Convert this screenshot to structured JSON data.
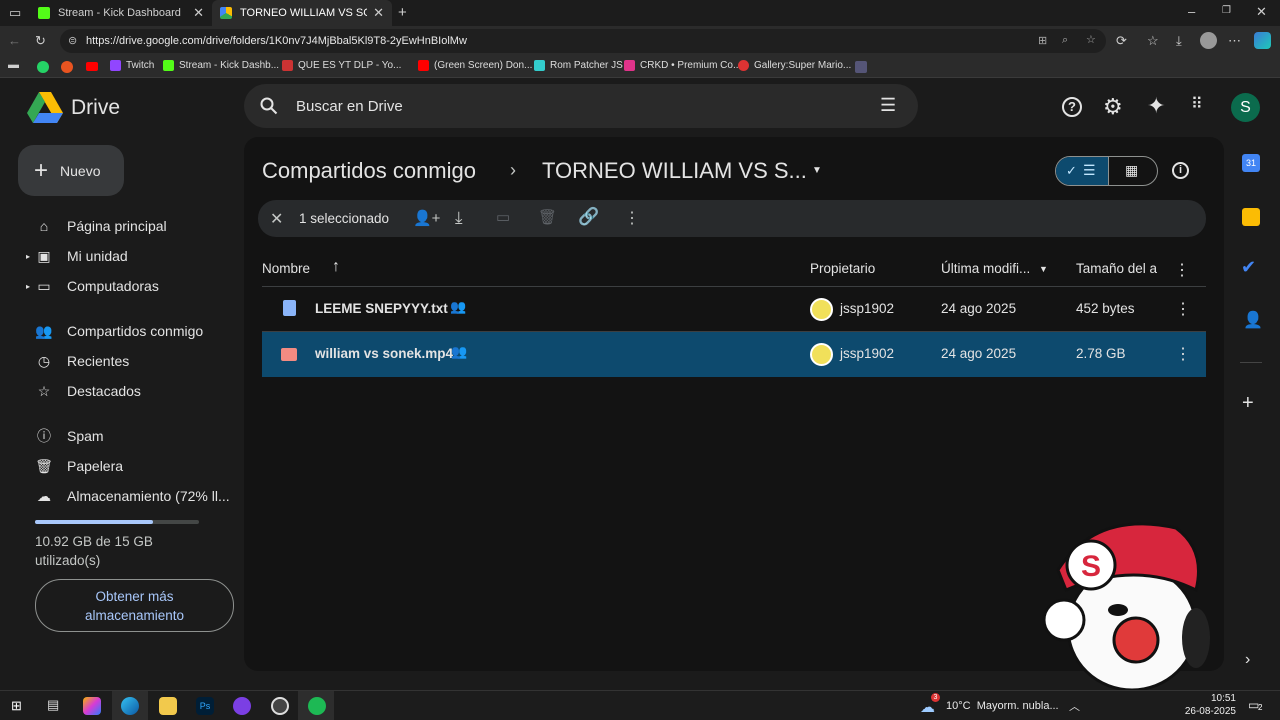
{
  "browser": {
    "tabs": [
      {
        "label": "Stream - Kick Dashboard",
        "favicon": "kick-icon",
        "color": "#53fc18"
      },
      {
        "label": "TORNEO WILLIAM VS SONEK - G",
        "favicon": "drive-icon",
        "color": "#4285f4"
      }
    ],
    "url": "https://drive.google.com/drive/folders/1K0nv7J4MjBbal5Kl9T8-2yEwHnBIolMw",
    "bookmarks": [
      {
        "label": "Twitch",
        "color": "#9146ff"
      },
      {
        "label": "Stream - Kick Dashb...",
        "color": "#53fc18"
      },
      {
        "label": "QUE ES YT DLP - Yo...",
        "color": "#ff0000"
      },
      {
        "label": "(Green Screen) Don...",
        "color": "#ff0000"
      },
      {
        "label": "Rom Patcher JS",
        "color": "#3cc"
      },
      {
        "label": "CRKD • Premium Co...",
        "color": "#e0338a"
      },
      {
        "label": "Gallery:Super Mario...",
        "color": "#d33"
      }
    ]
  },
  "drive": {
    "logo_text": "Drive",
    "search_placeholder": "Buscar en Drive",
    "new_button": "Nuevo",
    "avatar_letter": "S",
    "nav": [
      {
        "label": "Página principal",
        "icon": "home-icon"
      },
      {
        "label": "Mi unidad",
        "icon": "my-drive-icon"
      },
      {
        "label": "Computadoras",
        "icon": "computer-icon"
      },
      {
        "label": "Compartidos conmigo",
        "icon": "shared-icon"
      },
      {
        "label": "Recientes",
        "icon": "clock-icon"
      },
      {
        "label": "Destacados",
        "icon": "star-icon"
      },
      {
        "label": "Spam",
        "icon": "spam-icon"
      },
      {
        "label": "Papelera",
        "icon": "trash-icon"
      },
      {
        "label": "Almacenamiento (72% ll...",
        "icon": "cloud-icon"
      }
    ],
    "storage": {
      "used_fraction": 0.72,
      "text_line1": "10.92 GB de 15 GB",
      "text_line2": "utilizado(s)",
      "button": "Obtener más almacenamiento"
    },
    "breadcrumb": {
      "parent": "Compartidos conmigo",
      "current": "TORNEO WILLIAM VS S..."
    },
    "selection": {
      "label": "1 seleccionado"
    },
    "columns": {
      "name": "Nombre",
      "owner": "Propietario",
      "modified": "Última modifi...",
      "size": "Tamaño del a"
    },
    "files": [
      {
        "name": "LEEME SNEPYYY.txt",
        "type_icon": "doc-icon",
        "owner": "jssp1902",
        "modified": "24 ago 2025",
        "size": "452 bytes",
        "selected": false
      },
      {
        "name": "william vs sonek.mp4",
        "type_icon": "video-icon",
        "owner": "jssp1902",
        "modified": "24 ago 2025",
        "size": "2.78 GB",
        "selected": true
      }
    ],
    "right_panel": {
      "calendar_day": "31"
    },
    "colors": {
      "selected_row": "#0d4a6e",
      "accent": "#a8c7fa"
    }
  },
  "taskbar": {
    "weather": "10°C  Mayorm. nubla...",
    "time": "10:51",
    "date": "26-08-2025",
    "notifications": "2",
    "weather_badge": "3"
  }
}
